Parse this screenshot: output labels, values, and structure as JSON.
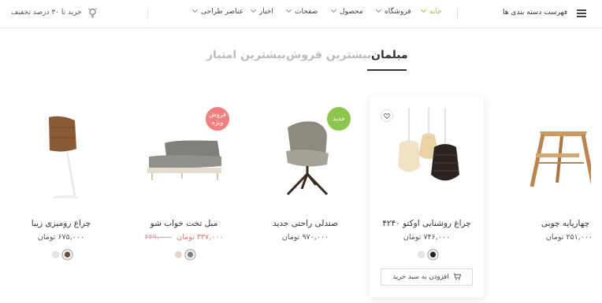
{
  "header": {
    "categories_label": "فهرست دسته بندی ها",
    "nav": [
      {
        "label": "خانه",
        "active": true
      },
      {
        "label": "فروشگاه",
        "active": false
      },
      {
        "label": "محصول",
        "active": false
      },
      {
        "label": "صفحات",
        "active": false
      },
      {
        "label": "اخبار",
        "active": false
      },
      {
        "label": "عناصر طراحی",
        "active": false
      }
    ],
    "promo": "خرید تا ۳۰ درصد تخفیف"
  },
  "tabs": [
    {
      "label": "مبلمان",
      "active": true
    },
    {
      "label": "بیشترین فروش",
      "active": false
    },
    {
      "label": "بیشترین امتیاز",
      "active": false
    }
  ],
  "products": [
    {
      "name": "چهارپایه چوبی",
      "price": "۲۵۱,۰۰۰ تومان",
      "image_icon": "wooden-stool-icon"
    },
    {
      "name": "چراغ روشنایی اوکتو ۴۲۴۰",
      "price": "۷۴۶,۰۰۰ تومان",
      "image_icon": "pendant-lamps-icon",
      "swatches": [
        "#222222",
        "#e6e6e6"
      ],
      "add_to_cart": "افزودن به سبد خرید"
    },
    {
      "name": "صندلی راحتی جدید",
      "price": "۹۷۰,۰۰۰ تومان",
      "badge": "جدید",
      "image_icon": "armchair-icon"
    },
    {
      "name": "مبل تخت خواب شو",
      "price_sale": "۳۳۷,۰۰۰ تومان",
      "price_old": "۴۴۹,۰۰۰",
      "badge": "فروش ویژه",
      "image_icon": "sofa-bed-icon",
      "swatches": [
        "#7e807c",
        "#e2d6c4"
      ]
    },
    {
      "name": "چراغ رومیزی زیبا",
      "price": "۶۷۵,۰۰۰ تومان",
      "image_icon": "desk-lamp-icon",
      "swatches": [
        "#6a4a35",
        "#e6e6e6"
      ]
    }
  ],
  "colors": {
    "accent_green": "#8cc44e",
    "sale_pink": "#f07f7f"
  }
}
